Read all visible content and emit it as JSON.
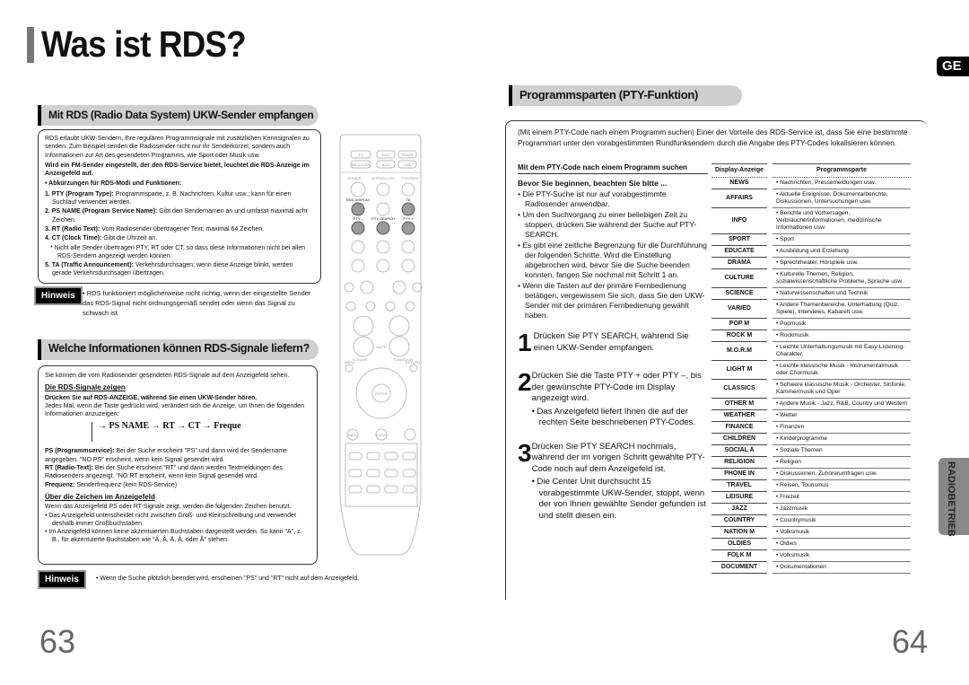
{
  "left": {
    "title": "Was ist RDS?",
    "section1": {
      "heading": "Mit RDS (Radio Data System) UKW-Sender empfangen",
      "intro": "RDS erlaubt UKW-Sendern, Ihre regulären Programmsignale mit zusätzlichen Kennsignalen zu senden. Zum Beispiel senden die Radiosender nicht nur ihr Senderkürzel, sondern auch Informationen zur Art des gesendeten Programms, wie Sport oder Musik usw.",
      "bold": "Wird ein FM-Sender eingestellt, der den RDS-Service bietet, leuchtet die RDS-Anzeige im Anzeigefeld auf.",
      "abbr_title": "• Abkürzungen für RDS-Modi und Funktionen:",
      "items": [
        {
          "term": "1. PTY (Program Type):",
          "text": " Programmsparte, z. B. Nachrichten, Kultur usw.; kann für einen Suchlauf verwendet werden."
        },
        {
          "term": "2. PS NAME (Program Service Name):",
          "text": " Gibt den Sendernamen an und umfasst maximal acht Zeichen."
        },
        {
          "term": "3. RT (Radio Text):",
          "text": " Vom Radiosender übertragener Text; maximal 64 Zeichen."
        },
        {
          "term": "4. CT (Clock Time):",
          "text": " Gibt die Uhrzeit an."
        },
        {
          "term": "5. TA (Traffic Announcement):",
          "text": " Verkehrsdurchsagen; wenn diese Anzeige blinkt, werden gerade Verkehrsdurchsagen übertragen."
        }
      ],
      "note": "* Nicht alle Sender übertragen PTY, RT oder CT, so dass diese Informationen nicht bei allen RDS-Sendern angezeigt werden können."
    },
    "hinweis1": {
      "label": "Hinweis",
      "text": "• RDS funktioniert möglicherweise nicht richtig, wenn der eingestellte Sender das RDS-Signal nicht ordnungsgemäß sendet oder wenn das Signal zu schwach ist."
    },
    "section2": {
      "heading": "Welche Informationen können RDS-Signale liefern?",
      "intro": "Sie können die vom Radiosender gesendeten RDS-Signale auf dem Anzeigefeld sehen.",
      "sub1": "Die RDS-Signale zeigen",
      "sub1_bold": "Drücken Sie auf RDS-ANZEIGE, während Sie einen UKW-Sender hören.",
      "sub1_text": "Jedes Mal, wenn die Taste gedrückt wird, verändert sich die Anzeige, um Ihnen die folgenden Informationen anzuzeigen:",
      "flow": "→ PS NAME → RT → CT → Freque",
      "defs": [
        {
          "term": "PS (Programmservice):",
          "text": " Bei der Suche erscheint \"PS\" und dann wird der Sendername angegeben. \"NO PS\" erscheint, wenn kein Signal gesendet wird."
        },
        {
          "term": "RT (Radio-Text):",
          "text": " Bei der Suche erscheint \"RT\" und dann werden Textmeldungen des Radiosenders angezeigt. \"NO RT erscheint, wenn kein Signal gesendet wird."
        },
        {
          "term": "Frequenz:",
          "text": " Senderfrequenz (kein RDS-Service)"
        }
      ],
      "sub2": "Über die Zeichen im Anzeigefeld",
      "sub2_text": "Wenn das Anzeigefeld PS oder RT-Signale zeigt, werden die folgenden Zeichen benutzt.",
      "bullets": [
        "• Das Anzeigefeld unterscheidet nicht zwischen Groß- und Kleinschreibung und verwendet deshalb immer Großbuchstaben.",
        "• Im Anzeigefeld können keine akzentuierten Buchstaben dargestellt werden. So kann \"A\", z. B., für akzentuierte Buchstaben wie \"Á, Â, Ä, À, oder Å\" stehen."
      ]
    },
    "hinweis2": {
      "label": "Hinweis",
      "text": "• Wenn die Suche plötzlich beendet wird, erscheinen \"PS\" und \"RT\" nicht auf dem Anzeigefeld."
    },
    "remote": {
      "buttons": {
        "tv": "TV",
        "dvd": "DVD",
        "tuner": "TUNER",
        "receiver": "RECEIVER",
        "aux": "AUX",
        "usb": "USB",
        "power": "POWER",
        "open": "OPEN/CLOSE",
        "tvvideo": "TV/VIDEO",
        "rds": "RDS DISPLAY",
        "ta": "TA",
        "ptym": "PTY -",
        "ptys": "PTY SEARCH",
        "ptyp": "PTY +",
        "mute": "MUTE",
        "volume": "VOLUME",
        "tuning": "TUNING/CH",
        "menu": "MENU",
        "return": "RETURN",
        "enter": "ENTER",
        "info": "INFO",
        "audio": "AUDIO"
      },
      "highlight_color": "#9a9a9a"
    },
    "page_number": "63"
  },
  "right": {
    "badge": "GE",
    "heading": "Programmsparten (PTY-Funktion)",
    "intro": "(Mit einem PTY-Code nach einem Programm suchen) Einer der Vorteile des RDS-Service ist, dass Sie eine bestimmte Programmart unter den vorabgestimmten Rundfunksendern durch die Angabe des PTY-Codes lokalisieren können.",
    "sub": "Mit dem PTY-Code nach einem Programm suchen",
    "before": "Bevor Sie beginnen, beachten Sie bitte ...",
    "bullets": [
      "• Die PTY-Suche ist nur auf vorabgestimmte Radiosender anwendbar.",
      "• Um den Suchvorgang zu einer beliebigen Zeit zu stoppen, drücken Sie während der Suche auf PTY-SEARCH.",
      "• Es gibt eine zeitliche Begrenzung für die Durchführung der folgenden Schritte. Wird die Einstellung abgebrochen wird, bevor Sie die Suche beenden konnten, fangen Sie nochmal mit Schritt 1 an.",
      "• Wenn die Tasten auf der primäre Fernbedienung betätigen, vergewissern Sie sich, dass Sie den UKW-Sender mit der primären Fernbedienung gewählt haben."
    ],
    "steps": [
      {
        "num": "1",
        "text": "Drücken Sie PTY SEARCH, während Sie einen UKW-Sender empfangen.",
        "sub": ""
      },
      {
        "num": "2",
        "text": "Drücken Sie die Taste PTY + oder PTY –, bis der gewünschte PTY-Code im Display angezeigt wird.",
        "sub": "• Das Anzeigefeld liefert Ihnen die auf der rechten Seite beschriebenen PTY-Codes."
      },
      {
        "num": "3",
        "text": "Drücken Sie PTY SEARCH nochmals, während der im vorigen Schritt gewählte PTY-Code noch auf dem Anzeigefeld ist.",
        "sub": "• Die Center Unit durchsucht 15 vorabgestimmte UKW-Sender, stoppt, wenn der von Ihnen gewählte Sender gefunden ist und stellt diesen ein."
      }
    ],
    "table": {
      "headers": [
        "Display-Anzeige",
        "Programmsparte"
      ],
      "rows": [
        [
          "NEWS",
          "• Nachrichten, Pressemeldungen usw."
        ],
        [
          "AFFAIRS",
          "• Aktuelle Ereignisse, Dokumentarberichte, Diskussionen, Untersuchungen usw."
        ],
        [
          "INFO",
          "• Berichte und Vorhersagen, Verbraucherinformationen, medizinische Informationen usw."
        ],
        [
          "SPORT",
          "• Sport"
        ],
        [
          "EDUCATE",
          "• Ausbildung und Erziehung"
        ],
        [
          "DRAMA",
          "• Sprechtheater, Hörspiele usw."
        ],
        [
          "CULTURE",
          "• Kulturelle Themen, Religion, sozialwissenschaftliche Probleme, Sprache usw."
        ],
        [
          "SCIENCE",
          "• Naturwissenschaften und Technik"
        ],
        [
          "VARIED",
          "• Andere Themenbereiche, Unterhaltung (Quiz, Spiele), Interviews, Kabarett usw."
        ],
        [
          "POP M",
          "• Popmusik"
        ],
        [
          "ROCK M",
          "• Rockmusik"
        ],
        [
          "M.O.R.M",
          "• Leichte Unterhaltungsmusik mit Easy-Listening-Charakter."
        ],
        [
          "LIGHT M",
          "• Leichte klassische Musik - Instrumentalmusik oder Chormusik."
        ],
        [
          "CLASSICS",
          "• Schwere klassische Musik - Orchester, Sinfonie, Kammermusik und Oper"
        ],
        [
          "OTHER M",
          "• Andere Musik - Jazz, R&B, Country und Western"
        ],
        [
          "WEATHER",
          "• Wetter"
        ],
        [
          "FINANCE",
          "• Finanzen"
        ],
        [
          "CHILDREN",
          "• Kinderprogramme"
        ],
        [
          "SOCIAL A",
          "• Soziale Themen"
        ],
        [
          "RELIGION",
          "• Religion"
        ],
        [
          "PHONE IN",
          "• Diskussionen, Zuhörerumfragen usw."
        ],
        [
          "TRAVEL",
          "• Reisen, Tourismus"
        ],
        [
          "LEISURE",
          "• Freizeit"
        ],
        [
          "JAZZ",
          "• Jazzmusik"
        ],
        [
          "COUNTRY",
          "• Countrymusik"
        ],
        [
          "NATION M",
          "• Volksmusik"
        ],
        [
          "OLDIES",
          "• Oldies"
        ],
        [
          "FOLK M",
          "• Volksmusik"
        ],
        [
          "DOCUMENT",
          "• Dokumentationen"
        ]
      ]
    },
    "side_tab": "RADIOBETRIEB",
    "page_number": "64"
  }
}
